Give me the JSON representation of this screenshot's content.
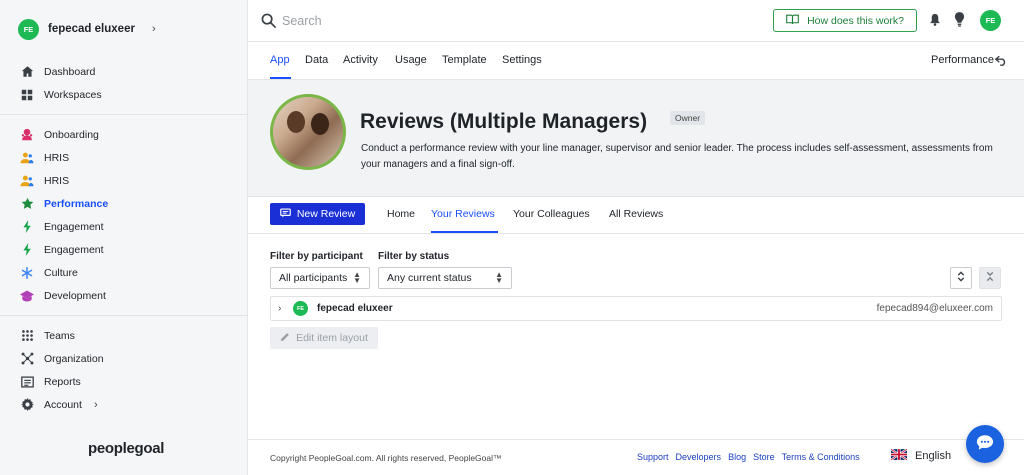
{
  "user": {
    "initials": "FE",
    "name": "fepecad eluxeer"
  },
  "sidebar": {
    "group1": [
      {
        "label": "Dashboard",
        "icon": "home-icon"
      },
      {
        "label": "Workspaces",
        "icon": "grid-icon"
      }
    ],
    "group2": [
      {
        "label": "Onboarding",
        "icon": "onboarding-icon"
      },
      {
        "label": "HRIS",
        "icon": "users-icon"
      },
      {
        "label": "HRIS",
        "icon": "users-icon"
      },
      {
        "label": "Performance",
        "icon": "star-icon",
        "active": true
      },
      {
        "label": "Engagement",
        "icon": "bolt-icon"
      },
      {
        "label": "Engagement",
        "icon": "bolt-icon"
      },
      {
        "label": "Culture",
        "icon": "asterisk-icon"
      },
      {
        "label": "Development",
        "icon": "graduation-cap-icon"
      }
    ],
    "group3": [
      {
        "label": "Teams",
        "icon": "teams-icon"
      },
      {
        "label": "Organization",
        "icon": "organization-icon"
      },
      {
        "label": "Reports",
        "icon": "reports-icon"
      },
      {
        "label": "Account",
        "icon": "gear-icon"
      }
    ],
    "logo": "peoplegoal"
  },
  "topbar": {
    "search_placeholder": "Search",
    "how_label": "How does this work?"
  },
  "subnav": {
    "tabs": [
      "App",
      "Data",
      "Activity",
      "Usage",
      "Template",
      "Settings"
    ],
    "active": "App",
    "performance_link": "Performance"
  },
  "app": {
    "title": "Reviews (Multiple Managers)",
    "badge": "Owner",
    "description": "Conduct a performance review with your line manager, supervisor and senior leader. The process includes self-assessment, assessments from your managers and a final sign-off."
  },
  "review_tabs": {
    "new_review_label": "New Review",
    "tabs": [
      "Home",
      "Your Reviews",
      "Your Colleagues",
      "All Reviews"
    ],
    "active": "Your Reviews"
  },
  "filters": {
    "participant_label": "Filter by participant",
    "participant_value": "All participants",
    "status_label": "Filter by status",
    "status_value": "Any current status"
  },
  "participants": [
    {
      "initials": "FE",
      "name": "fepecad eluxeer",
      "email": "fepecad894@eluxeer.com"
    }
  ],
  "edit_layout_label": "Edit item layout",
  "footer": {
    "copyright": "Copyright PeopleGoal.com. All rights reserved, PeopleGoal™",
    "links": [
      "Support",
      "Developers",
      "Blog",
      "Store",
      "Terms & Conditions"
    ],
    "language": "English"
  },
  "colors": {
    "accent": "#1a4fff",
    "primary_button": "#1a2fd6",
    "avatar": "#1db954",
    "how_border": "#2e9f4a",
    "chat": "#1a62e0"
  }
}
